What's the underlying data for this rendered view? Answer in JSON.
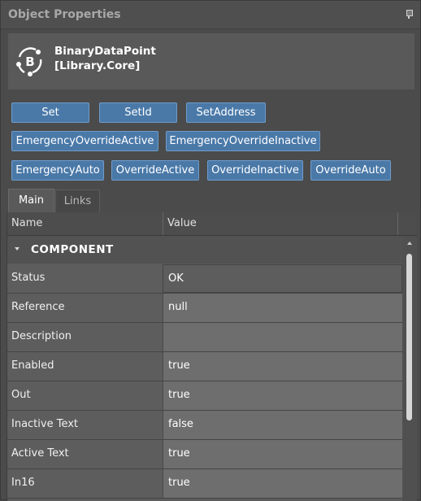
{
  "panel": {
    "title": "Object Properties"
  },
  "header": {
    "name_line1": "BinaryDataPoint",
    "name_line2": "[Library.Core]",
    "logo_letter": "B"
  },
  "actions": {
    "row1": [
      "Set",
      "SetId",
      "SetAddress"
    ],
    "row2": [
      "EmergencyOverrideActive",
      "EmergencyOverrideInactive"
    ],
    "row3": [
      "EmergencyAuto",
      "OverrideActive",
      "OverrideInactive",
      "OverrideAuto"
    ]
  },
  "tabs": [
    "Main",
    "Links"
  ],
  "grid": {
    "columns": [
      "Name",
      "Value"
    ],
    "category": "COMPONENT",
    "rows": [
      {
        "name": "Status",
        "value": "OK"
      },
      {
        "name": "Reference",
        "value": "null"
      },
      {
        "name": "Description",
        "value": ""
      },
      {
        "name": "Enabled",
        "value": "true"
      },
      {
        "name": "Out",
        "value": "true"
      },
      {
        "name": "Inactive Text",
        "value": "false"
      },
      {
        "name": "Active Text",
        "value": "true"
      },
      {
        "name": "In16",
        "value": "true"
      }
    ]
  },
  "colors": {
    "button": "#4a79a8",
    "panel": "#4b4b4b"
  },
  "icons": {
    "pin": "pin-icon",
    "logo": "binary-datapoint-icon"
  }
}
